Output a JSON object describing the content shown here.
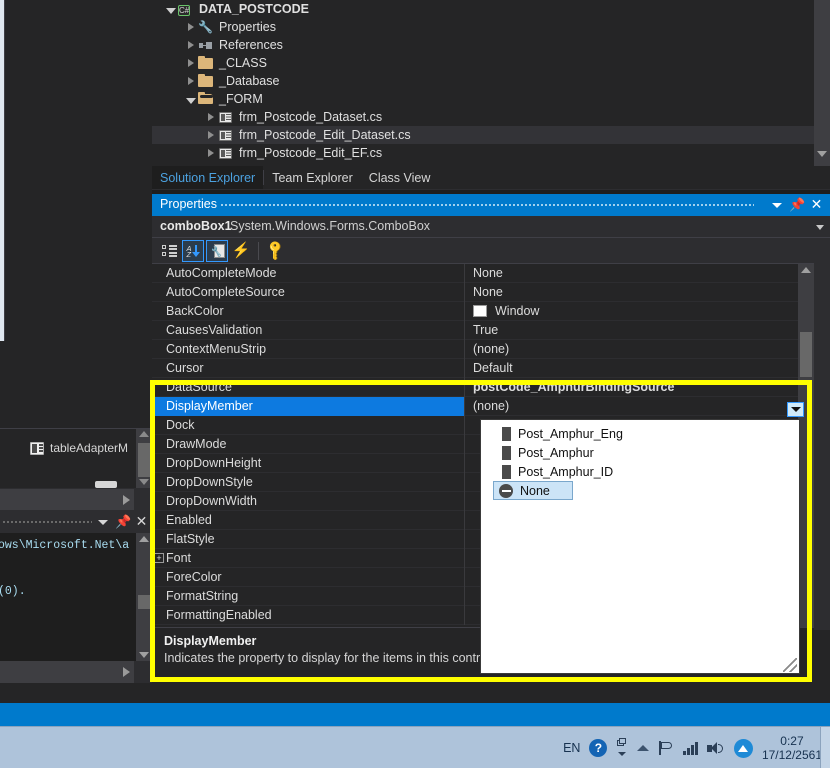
{
  "solution_explorer": {
    "tree": [
      {
        "indent": 0,
        "expander": "expanded",
        "icon": "csharp-project-icon",
        "label": "DATA_POSTCODE",
        "bold": true,
        "selected": false
      },
      {
        "indent": 1,
        "expander": "collapsed",
        "icon": "wrench-icon",
        "label": "Properties",
        "bold": false,
        "selected": false
      },
      {
        "indent": 1,
        "expander": "collapsed",
        "icon": "references-icon",
        "label": "References",
        "bold": false,
        "selected": false
      },
      {
        "indent": 1,
        "expander": "collapsed",
        "icon": "folder-icon",
        "label": "_CLASS",
        "bold": false,
        "selected": false
      },
      {
        "indent": 1,
        "expander": "collapsed",
        "icon": "folder-icon",
        "label": "_Database",
        "bold": false,
        "selected": false
      },
      {
        "indent": 1,
        "expander": "expanded",
        "icon": "folder-open-icon",
        "label": "_FORM",
        "bold": false,
        "selected": false
      },
      {
        "indent": 2,
        "expander": "collapsed",
        "icon": "windows-form-icon",
        "label": "frm_Postcode_Dataset.cs",
        "bold": false,
        "selected": false
      },
      {
        "indent": 2,
        "expander": "collapsed",
        "icon": "windows-form-icon",
        "label": "frm_Postcode_Edit_Dataset.cs",
        "bold": false,
        "selected": true
      },
      {
        "indent": 2,
        "expander": "collapsed",
        "icon": "windows-form-icon",
        "label": "frm_Postcode_Edit_EF.cs",
        "bold": false,
        "selected": false
      }
    ],
    "tabs": [
      {
        "label": "Solution Explorer",
        "active": true
      },
      {
        "label": "Team Explorer",
        "active": false
      },
      {
        "label": "Class View",
        "active": false
      }
    ]
  },
  "properties_window": {
    "title": "Properties",
    "object_name": "comboBox1",
    "object_type": "System.Windows.Forms.ComboBox",
    "toolbar": [
      {
        "name": "categorized-button",
        "icon": "categorized-icon",
        "active": false
      },
      {
        "name": "alphabetical-button",
        "icon": "sort-az-icon",
        "active": true
      },
      {
        "name": "properties-button",
        "icon": "properties-page-icon",
        "active": true
      },
      {
        "name": "events-button",
        "icon": "lightning-bolt-icon",
        "active": false
      },
      {
        "name": "property-pages-button",
        "icon": "key-icon",
        "active": false
      }
    ],
    "rows": [
      {
        "name": "AutoCompleteMode",
        "value": "None",
        "kind": "text",
        "expandable": false,
        "selected": false
      },
      {
        "name": "AutoCompleteSource",
        "value": "None",
        "kind": "text",
        "expandable": false,
        "selected": false
      },
      {
        "name": "BackColor",
        "value": "Window",
        "kind": "color",
        "swatch": "#ffffff",
        "expandable": false,
        "selected": false
      },
      {
        "name": "CausesValidation",
        "value": "True",
        "kind": "text",
        "expandable": false,
        "selected": false
      },
      {
        "name": "ContextMenuStrip",
        "value": "(none)",
        "kind": "text",
        "expandable": false,
        "selected": false
      },
      {
        "name": "Cursor",
        "value": "Default",
        "kind": "text",
        "expandable": false,
        "selected": false
      },
      {
        "name": "DataSource",
        "value": "postCode_AmphurBindingSource",
        "kind": "bold",
        "expandable": false,
        "selected": false
      },
      {
        "name": "DisplayMember",
        "value": "(none)",
        "kind": "editing",
        "expandable": false,
        "selected": true
      },
      {
        "name": "Dock",
        "value": "",
        "kind": "text",
        "expandable": false,
        "selected": false
      },
      {
        "name": "DrawMode",
        "value": "",
        "kind": "text",
        "expandable": false,
        "selected": false
      },
      {
        "name": "DropDownHeight",
        "value": "",
        "kind": "text",
        "expandable": false,
        "selected": false
      },
      {
        "name": "DropDownStyle",
        "value": "",
        "kind": "text",
        "expandable": false,
        "selected": false
      },
      {
        "name": "DropDownWidth",
        "value": "",
        "kind": "text",
        "expandable": false,
        "selected": false
      },
      {
        "name": "Enabled",
        "value": "",
        "kind": "text",
        "expandable": false,
        "selected": false
      },
      {
        "name": "FlatStyle",
        "value": "",
        "kind": "text",
        "expandable": false,
        "selected": false
      },
      {
        "name": "Font",
        "value": "",
        "kind": "text",
        "expandable": true,
        "selected": false
      },
      {
        "name": "ForeColor",
        "value": "",
        "kind": "text",
        "expandable": false,
        "selected": false
      },
      {
        "name": "FormatString",
        "value": "",
        "kind": "text",
        "expandable": false,
        "selected": false
      },
      {
        "name": "FormattingEnabled",
        "value": "",
        "kind": "text",
        "expandable": false,
        "selected": false
      }
    ],
    "description": {
      "title": "DisplayMember",
      "text": "Indicates the property to display for the items in this control."
    }
  },
  "dropdown": {
    "items": [
      {
        "label": "None",
        "icon": "none-circle-icon",
        "selected": true
      },
      {
        "label": "Post_Amphur_ID",
        "icon": "field-icon",
        "selected": false
      },
      {
        "label": "Post_Amphur",
        "icon": "field-icon",
        "selected": false
      },
      {
        "label": "Post_Amphur_Eng",
        "icon": "field-icon",
        "selected": false
      }
    ]
  },
  "designer_tray": {
    "item_label": "tableAdapterM"
  },
  "output_window": {
    "line1": "ows\\Microsoft.Net\\a",
    "line2": "(0)."
  },
  "taskbar": {
    "language": "EN",
    "help_glyph": "?",
    "time": "0:27",
    "date": "17/12/2561"
  },
  "colors": {
    "accent_blue": "#007acc",
    "selection_blue": "#0d7ae0",
    "highlight_yellow": "#ffff00",
    "folder_tan": "#dcb67a",
    "taskbar_blue": "#aec3da"
  }
}
